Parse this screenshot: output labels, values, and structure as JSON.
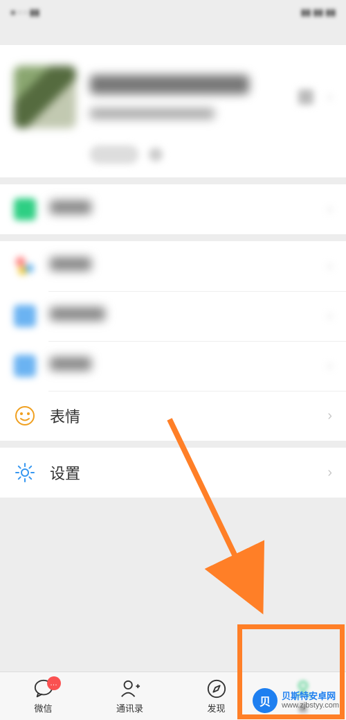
{
  "statusbar": {
    "left_blurred": true,
    "right_blurred": true
  },
  "profile": {
    "blurred": true,
    "has_qr": true
  },
  "groups": [
    {
      "cells": [
        {
          "id": "pay",
          "blurred": true,
          "icon": "pay-icon"
        }
      ]
    },
    {
      "cells": [
        {
          "id": "favorites",
          "blurred": true,
          "icon": "favorites-icon"
        },
        {
          "id": "moments",
          "blurred": true,
          "icon": "moments-icon"
        },
        {
          "id": "cards",
          "blurred": true,
          "icon": "cards-icon"
        },
        {
          "id": "emoji",
          "label": "表情",
          "icon": "emoji-icon"
        }
      ]
    },
    {
      "cells": [
        {
          "id": "settings",
          "label": "设置",
          "icon": "gear-icon"
        }
      ]
    }
  ],
  "tabs": {
    "chat": {
      "label": "微信",
      "badge": "…"
    },
    "contacts": {
      "label": "通讯录"
    },
    "discover": {
      "label": "发现"
    },
    "me": {
      "label": "我",
      "active": true
    }
  },
  "annotation": {
    "arrow_color": "#ff7f27",
    "box_color": "#ff7f27"
  },
  "watermark": {
    "brand": "贝斯特安卓网",
    "url": "www.zjbstyy.com"
  }
}
